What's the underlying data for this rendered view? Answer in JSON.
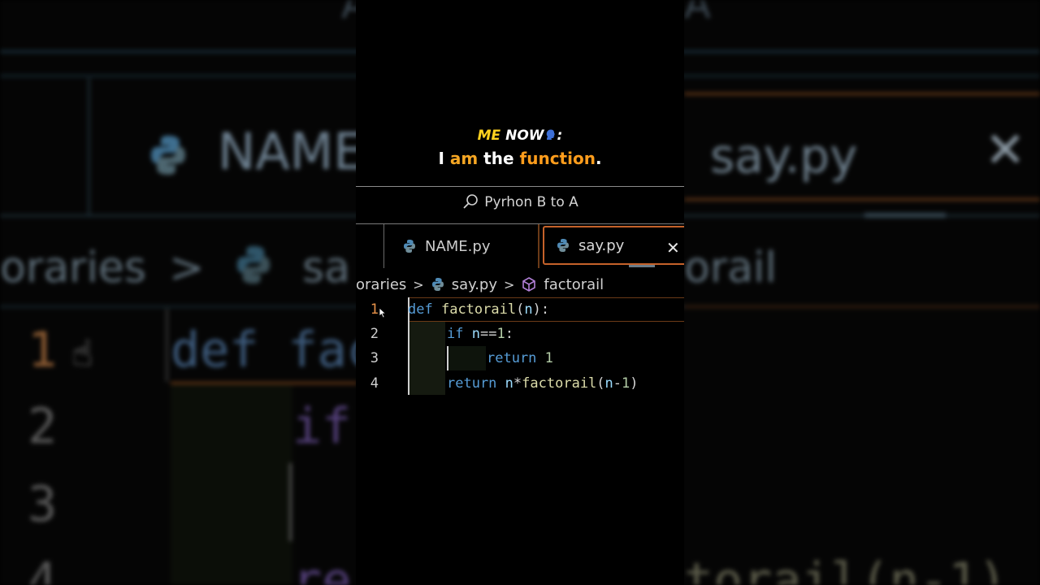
{
  "caption": {
    "line1_a": "ME",
    "line1_b": "NOW",
    "line1_c": ":",
    "line2_a": "I",
    "line2_b": "am",
    "line2_c": "the",
    "line2_d": "function",
    "line2_e": "."
  },
  "search": {
    "text": "Pyrhon B to A",
    "icon": "search-icon"
  },
  "tabs": [
    {
      "label": "NAME.py",
      "icon": "python-icon"
    },
    {
      "label": "say.py",
      "icon": "python-icon",
      "active": true
    }
  ],
  "breadcrumb": {
    "part1": "oraries",
    "part2": "say.py",
    "part3": "factorail"
  },
  "editor": {
    "lines": [
      {
        "num": "1",
        "tokens": [
          "def",
          "factorail",
          "(",
          "n",
          "):"
        ]
      },
      {
        "num": "2",
        "tokens": [
          "if",
          "n",
          "==",
          "1",
          ":"
        ]
      },
      {
        "num": "3",
        "tokens": [
          "return",
          "1"
        ]
      },
      {
        "num": "4",
        "tokens": [
          "return",
          "n",
          "*",
          "factorail",
          "(",
          "n",
          "-",
          "1",
          ")"
        ]
      }
    ]
  },
  "background": {
    "tab_left": "NAME",
    "tab_right": "say.py",
    "breadcrumb_left": "oraries",
    "breadcrumb_mid": "sa",
    "breadcrumb_right": "orail",
    "code_line1": "def fac",
    "code_line2": "if",
    "code_line4": "re",
    "code_right4": "torail(n-1)",
    "num1": "1",
    "num2": "2",
    "num3": "3",
    "num4": "4",
    "top_left_char": "A",
    "top_right_char": "A"
  },
  "colors": {
    "accent_orange": "#c5622a",
    "caption_yellow": "#ffd21f",
    "caption_orange": "#ff9d1c",
    "keyword_blue": "#569cd6",
    "function_yellow": "#dcdcaa"
  }
}
